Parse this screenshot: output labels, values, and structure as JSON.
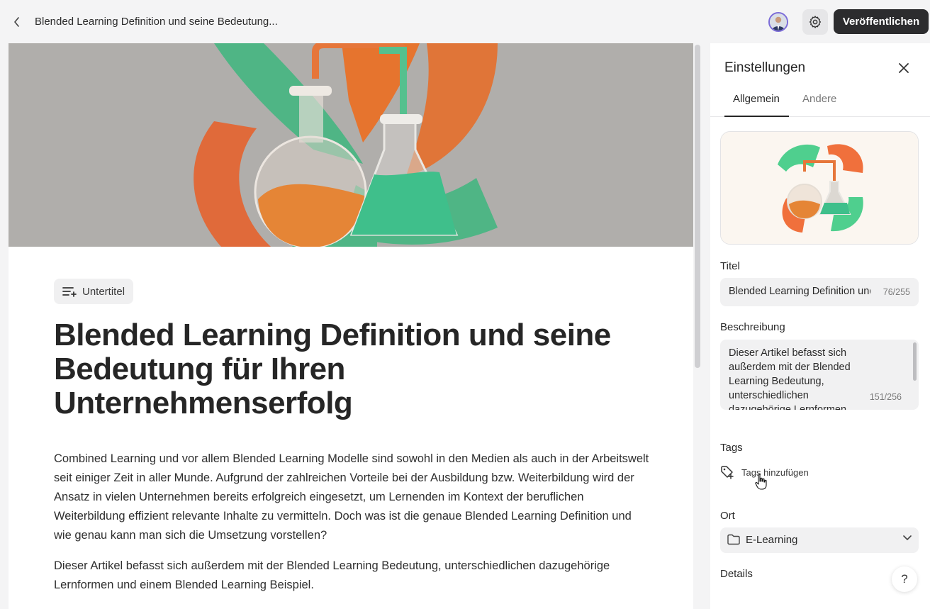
{
  "header": {
    "doc_title": "Blended Learning Definition und seine Bedeutung...",
    "publish_label": "Veröffentlichen"
  },
  "editor": {
    "subtitle_label": "Untertitel",
    "article_title": "Blended Learning Definition und seine Bedeutung für Ihren Unternehmenserfolg",
    "paragraphs": [
      "Combined Learning und vor allem Blended Learning Modelle sind sowohl in den Medien als auch in der Arbeitswelt seit einiger Zeit in aller Munde. Aufgrund der zahlreichen Vorteile bei der Ausbildung bzw. Weiterbildung wird der Ansatz in vielen Unternehmen bereits erfolgreich eingesetzt, um Lernenden im Kontext der beruflichen Weiterbildung effizient relevante Inhalte zu vermitteln. Doch was ist die genaue Blended Learning Definition und wie genau kann man sich die Umsetzung vorstellen?",
      "Dieser Artikel befasst sich außerdem mit der Blended Learning Bedeutung, unterschiedlichen dazugehörige Lernformen und einem Blended Learning Beispiel."
    ]
  },
  "settings": {
    "title": "Einstellungen",
    "tabs": [
      {
        "label": "Allgemein",
        "active": true
      },
      {
        "label": "Andere",
        "active": false
      }
    ],
    "title_label": "Titel",
    "title_value": "Blended Learning Definition und seine Bedeutung für Ihren Unternehmenserfolg",
    "title_counter": "76/255",
    "description_label": "Beschreibung",
    "description_value": "Dieser Artikel befasst sich außerdem mit der Blended Learning Bedeutung, unterschiedlichen dazugehörige Lernformen",
    "description_counter": "151/256",
    "tags_label": "Tags",
    "add_tags_label": "Tags hinzufügen",
    "location_label": "Ort",
    "location_value": "E-Learning",
    "details_label": "Details"
  },
  "help_label": "?",
  "colors": {
    "green": "#4fcf8e",
    "orange": "#f0703c",
    "dark_button": "#2c2c2e"
  },
  "icons": [
    "chevron-left-icon",
    "gear-icon",
    "subtitle-add-icon",
    "close-icon",
    "tag-add-icon",
    "folder-icon",
    "chevron-down-icon",
    "pointer-cursor-icon"
  ]
}
